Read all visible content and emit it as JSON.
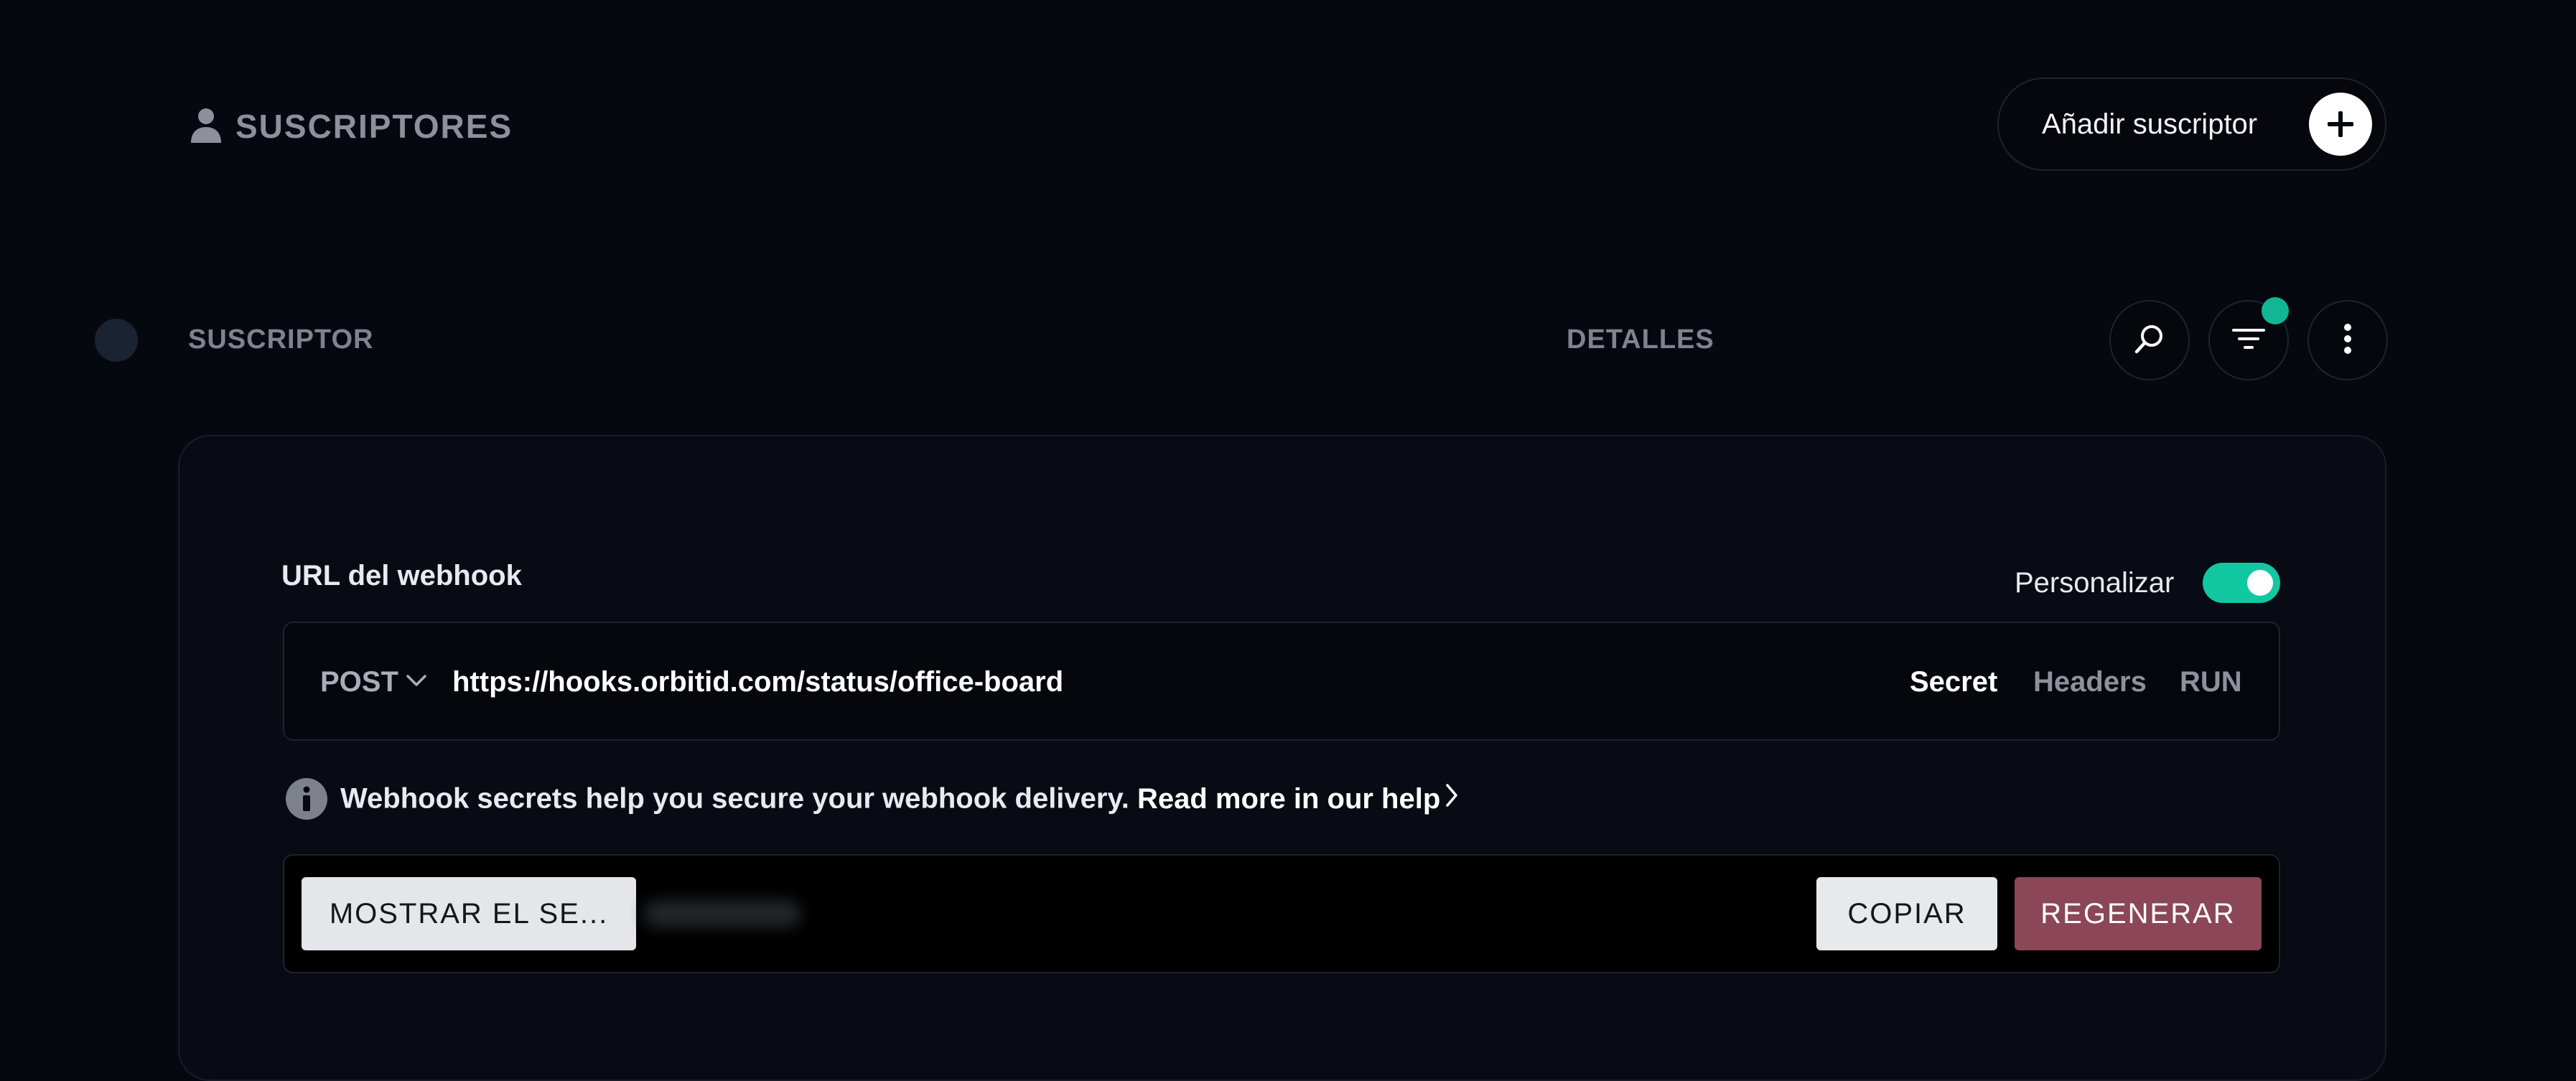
{
  "header": {
    "title": "SUSCRIPTORES",
    "title_icon": "person-icon",
    "add_button_label": "Añadir suscriptor",
    "add_button_icon": "plus-icon"
  },
  "table_header": {
    "col_subscriber": "SUSCRIPTOR",
    "col_details": "DETALLES",
    "actions": [
      "search-icon",
      "filter-icon",
      "more-vertical-icon"
    ],
    "filter_badge_color": "#12b596"
  },
  "webhook": {
    "field_label": "URL del webhook",
    "customize_label": "Personalizar",
    "customize_enabled": true,
    "method": "POST",
    "url": "https://hooks.orbitid.com/status/office-board",
    "tabs": [
      {
        "label": "Secret",
        "active": true
      },
      {
        "label": "Headers",
        "active": false
      },
      {
        "label": "RUN",
        "active": false
      }
    ],
    "info_text": "Webhook secrets help you secure your webhook delivery.",
    "help_link_label": "Read more in our help",
    "show_secret_label": "MOSTRAR EL SE...",
    "copy_label": "COPIAR",
    "regenerate_label": "REGENERAR"
  },
  "colors": {
    "background": "#060810",
    "accent_green": "#12c8a3",
    "regenerate": "#8b4658"
  }
}
